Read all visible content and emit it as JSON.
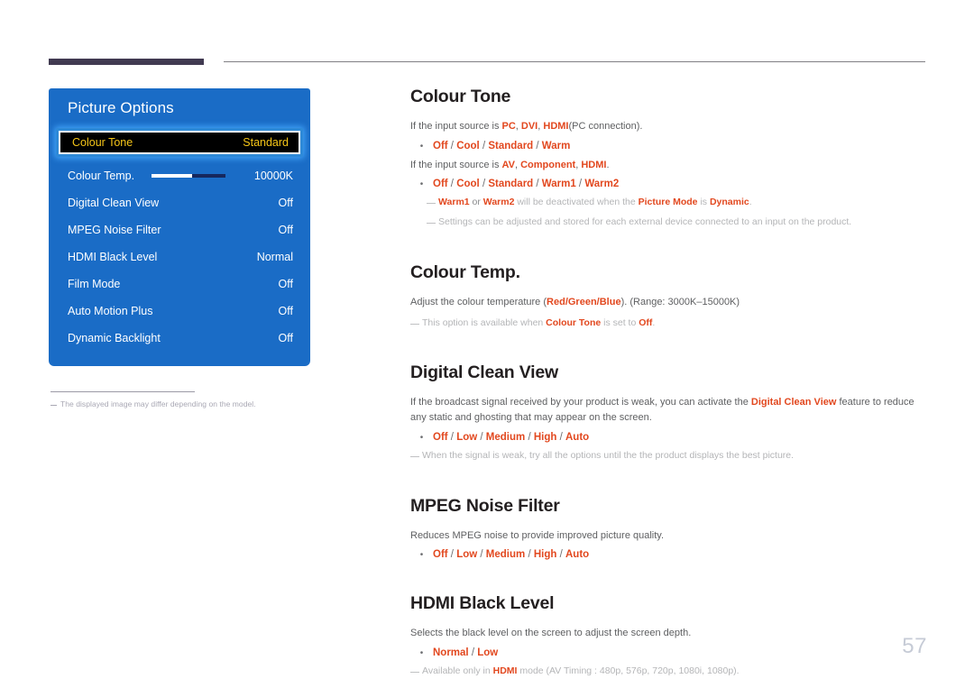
{
  "page": {
    "number": "57",
    "accent_color": "#e2481f",
    "panel_color": "#1a6cc6",
    "rule_color": "#413a51"
  },
  "osd": {
    "title": "Picture Options",
    "selected": {
      "label": "Colour Tone",
      "value": "Standard"
    },
    "rows": [
      {
        "label": "Colour Temp.",
        "value": "10000K",
        "slider": 55
      },
      {
        "label": "Digital Clean View",
        "value": "Off"
      },
      {
        "label": "MPEG Noise Filter",
        "value": "Off"
      },
      {
        "label": "HDMI Black Level",
        "value": "Normal"
      },
      {
        "label": "Film Mode",
        "value": "Off"
      },
      {
        "label": "Auto Motion Plus",
        "value": "Off"
      },
      {
        "label": "Dynamic Backlight",
        "value": "Off"
      }
    ],
    "footnote": "The displayed image may differ depending on the model."
  },
  "sections": {
    "colour_tone": {
      "heading": "Colour Tone",
      "line1_a": "If the input source is ",
      "line1_pc": "PC",
      "line1_c1": ", ",
      "line1_dvi": "DVI",
      "line1_c2": ", ",
      "line1_hdmi": "HDMI",
      "line1_b": "(PC connection).",
      "options1": [
        "Off",
        "Cool",
        "Standard",
        "Warm"
      ],
      "line2_a": "If the input source is ",
      "line2_av": "AV",
      "line2_c1": ", ",
      "line2_comp": "Component",
      "line2_c2": ", ",
      "line2_hdmi": "HDMI",
      "line2_b": ".",
      "options2": [
        "Off",
        "Cool",
        "Standard",
        "Warm1",
        "Warm2"
      ],
      "note1_w1": "Warm1",
      "note1_or": " or ",
      "note1_w2": "Warm2",
      "note1_mid": " will be deactivated when the ",
      "note1_pm": "Picture Mode",
      "note1_is": " is ",
      "note1_dyn": "Dynamic",
      "note1_end": ".",
      "note2": "Settings can be adjusted and stored for each external device connected to an input on the product."
    },
    "colour_temp": {
      "heading": "Colour Temp.",
      "line1_a": "Adjust the colour temperature (",
      "line1_red": "Red",
      "line1_s1": "/",
      "line1_green": "Green",
      "line1_s2": "/",
      "line1_blue": "Blue",
      "line1_b": "). (Range: 3000K–15000K)",
      "note_a": "This option is available when ",
      "note_ct": "Colour Tone",
      "note_b": " is set to ",
      "note_off": "Off",
      "note_c": "."
    },
    "digital_clean_view": {
      "heading": "Digital Clean View",
      "line1_a": "If the broadcast signal received by your product is weak, you can activate the ",
      "line1_dcv": "Digital Clean View",
      "line1_b": " feature to reduce any static and ghosting that may appear on the screen.",
      "options": [
        "Off",
        "Low",
        "Medium",
        "High",
        "Auto"
      ],
      "note": "When the signal is weak, try all the options until the the product displays the best picture."
    },
    "mpeg_noise_filter": {
      "heading": "MPEG Noise Filter",
      "line1": "Reduces MPEG noise to provide improved picture quality.",
      "options": [
        "Off",
        "Low",
        "Medium",
        "High",
        "Auto"
      ]
    },
    "hdmi_black_level": {
      "heading": "HDMI Black Level",
      "line1": "Selects the black level on the screen to adjust the screen depth.",
      "options": [
        "Normal",
        "Low"
      ],
      "note_a": "Available only in ",
      "note_hdmi": "HDMI",
      "note_b": " mode (AV Timing : 480p, 576p, 720p, 1080i, 1080p)."
    }
  }
}
